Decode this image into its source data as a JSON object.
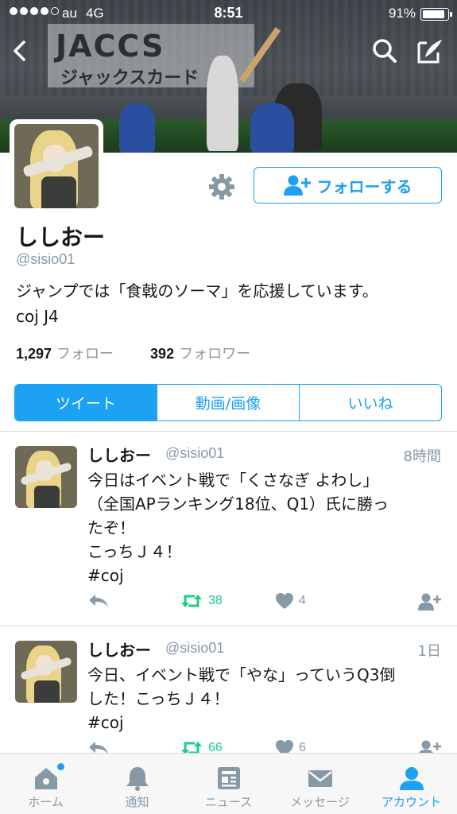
{
  "status_bar": {
    "carrier": "au",
    "network": "4G",
    "time": "8:51",
    "battery": "91%",
    "battery_level": 0.91
  },
  "banner": {
    "ad_logo": "JACCS",
    "ad_sub": "ジャックスカード"
  },
  "profile": {
    "display_name": "ししおー",
    "handle": "@sisio01",
    "bio_line1": "ジャンプでは「食戟のソーマ」を応援しています。",
    "bio_line2": "coj J4",
    "following_count": "1,297",
    "following_label": "フォロー",
    "followers_count": "392",
    "followers_label": "フォロワー",
    "follow_button": "フォローする"
  },
  "segments": [
    "ツイート",
    "動画/画像",
    "いいね"
  ],
  "tweets": [
    {
      "name": "ししおー",
      "handle": "@sisio01",
      "time": "8時間",
      "text": "今日はイベント戦で「くさなぎ よわし」\n（全国APランキング18位、Q1）氏に勝っ\nたぞ！\nこっちＪ４！\n#coj",
      "retweets": "38",
      "likes": "4"
    },
    {
      "name": "ししおー",
      "handle": "@sisio01",
      "time": "1日",
      "text": "今日、イベント戦で「やな」っていうQ3倒\nした！こっちＪ４！\n#coj",
      "retweets": "66",
      "likes": "6"
    }
  ],
  "tabbar": [
    {
      "label": "ホーム",
      "icon": "home-icon"
    },
    {
      "label": "通知",
      "icon": "bell-icon"
    },
    {
      "label": "ニュース",
      "icon": "news-icon"
    },
    {
      "label": "メッセージ",
      "icon": "envelope-icon"
    },
    {
      "label": "アカウント",
      "icon": "person-icon"
    }
  ],
  "colors": {
    "accent": "#1da1f2",
    "retweet": "#19cf86",
    "muted": "#8899a6"
  }
}
